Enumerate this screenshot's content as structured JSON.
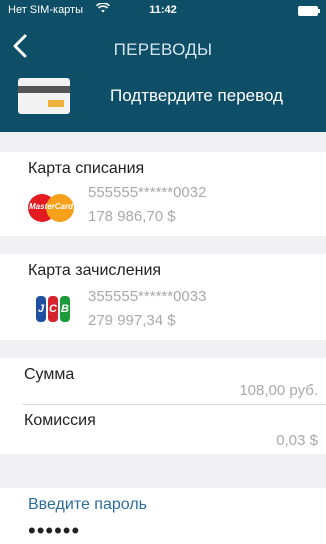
{
  "status_bar": {
    "carrier": "Нет SIM-карты",
    "wifi_icon": "wifi-icon",
    "time": "11:42",
    "battery_icon": "battery-icon"
  },
  "nav": {
    "back_icon": "chevron-left-icon",
    "title": "ПЕРЕВОДЫ"
  },
  "header": {
    "card_icon": "credit-card-icon",
    "text": "Подтвердите перевод"
  },
  "debit": {
    "title": "Карта списания",
    "brand_icon": "mastercard-icon",
    "brand_text": "MasterCard",
    "card_number": "555555******0032",
    "balance": "178 986,70 $"
  },
  "credit": {
    "title": "Карта зачисления",
    "brand_icon": "jcb-icon",
    "brand_letters": [
      "J",
      "C",
      "B"
    ],
    "card_number": "355555******0033",
    "balance": "279 997,34 $"
  },
  "amount": {
    "label": "Сумма",
    "value": "108,00 руб."
  },
  "commission": {
    "label": "Комиссия",
    "value": "0,03 $"
  },
  "password": {
    "label": "Введите пароль",
    "value": "••••••"
  },
  "colors": {
    "header_bg": "#0f4e67",
    "section_gap": "#efeff4",
    "link_blue": "#2a6e9b"
  }
}
